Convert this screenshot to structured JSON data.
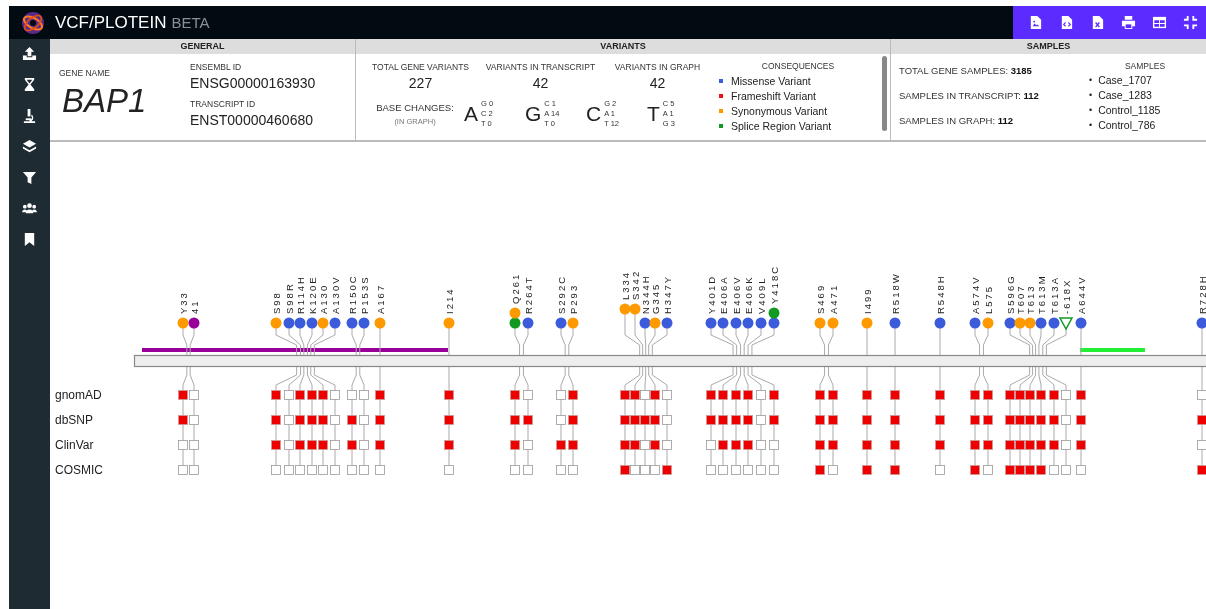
{
  "app": {
    "title": "VCF/PLOTEIN",
    "badge": "BETA"
  },
  "toolbar": [
    {
      "kind": "image-file"
    },
    {
      "kind": "code-file"
    },
    {
      "kind": "excel-file"
    },
    {
      "kind": "print"
    },
    {
      "kind": "table"
    },
    {
      "kind": "collapse"
    }
  ],
  "sidebar": [
    {
      "kind": "upload"
    },
    {
      "kind": "hourglass"
    },
    {
      "kind": "microscope"
    },
    {
      "kind": "layers"
    },
    {
      "kind": "filter"
    },
    {
      "kind": "users"
    },
    {
      "kind": "bookmark"
    }
  ],
  "general": {
    "heading": "GENERAL",
    "gene_name_label": "GENE NAME",
    "gene_name": "BAP1",
    "ensembl_label": "ENSEMBL ID",
    "ensembl_id": "ENSG00000163930",
    "transcript_label": "TRANSCRIPT ID",
    "transcript_id": "ENST00000460680"
  },
  "variants_panel": {
    "heading": "VARIANTS",
    "stats": [
      {
        "label": "TOTAL GENE VARIANTS",
        "value": "227"
      },
      {
        "label": "VARIANTS IN TRANSCRIPT",
        "value": "42"
      },
      {
        "label": "VARIANTS IN GRAPH",
        "value": "42"
      }
    ],
    "base_changes_label": "BASE CHANGES:",
    "base_changes_note": "(IN GRAPH)",
    "bases": [
      {
        "base": "A",
        "changes": [
          "G 0",
          "C 2",
          "T 0"
        ]
      },
      {
        "base": "G",
        "changes": [
          "C 1",
          "A 14",
          "T 0"
        ]
      },
      {
        "base": "C",
        "changes": [
          "G 2",
          "A 1",
          "T 12"
        ]
      },
      {
        "base": "T",
        "changes": [
          "C 5",
          "A 1",
          "G 3"
        ]
      }
    ],
    "consequences_heading": "CONSEQUENCES",
    "consequences": [
      {
        "label": "Missense Variant",
        "color": "#3b5bdb"
      },
      {
        "label": "Frameshift Variant",
        "color": "#ee1111"
      },
      {
        "label": "Synonymous Variant",
        "color": "#ff9900"
      },
      {
        "label": "Splice Region Variant",
        "color": "#119922"
      }
    ]
  },
  "samples_panel": {
    "heading": "SAMPLES",
    "stats": [
      {
        "label": "TOTAL GENE SAMPLES:",
        "value": "3185"
      },
      {
        "label": "SAMPLES IN TRANSCRIPT:",
        "value": "112"
      },
      {
        "label": "SAMPLES IN GRAPH:",
        "value": "112"
      }
    ],
    "list_heading": "SAMPLES",
    "bullet": "•",
    "samples": [
      "Case_1707",
      "Case_1283",
      "Control_1185",
      "Control_786"
    ]
  },
  "plot": {
    "databases": [
      "gnomAD",
      "dbSNP",
      "ClinVar",
      "COSMIC"
    ],
    "domains": [
      {
        "color": "#990099"
      },
      {
        "color": "#22ee33"
      }
    ],
    "variants": [
      {
        "label": "Y33",
        "kind": "circle",
        "dots": [
          {
            "color": "#ff9900"
          }
        ],
        "found": [
          true,
          true,
          false,
          false
        ]
      },
      {
        "label": "41",
        "kind": "circle",
        "dots": [
          {
            "color": "#990099"
          }
        ],
        "found": [
          false,
          false,
          false,
          false
        ]
      },
      {
        "label": "S98",
        "kind": "circle",
        "dots": [
          {
            "color": "#ff9900"
          }
        ],
        "found": [
          true,
          true,
          true,
          false
        ]
      },
      {
        "label": "S98R",
        "kind": "circle",
        "dots": [
          {
            "color": "#3b5bdb"
          }
        ],
        "found": [
          false,
          false,
          false,
          false
        ]
      },
      {
        "label": "R114H",
        "kind": "circle",
        "dots": [
          {
            "color": "#3b5bdb"
          }
        ],
        "found": [
          true,
          true,
          true,
          false
        ]
      },
      {
        "label": "K120E",
        "kind": "circle",
        "dots": [
          {
            "color": "#3b5bdb"
          }
        ],
        "found": [
          true,
          true,
          true,
          false
        ]
      },
      {
        "label": "A130",
        "kind": "circle",
        "dots": [
          {
            "color": "#ff9900"
          }
        ],
        "found": [
          true,
          true,
          true,
          false
        ]
      },
      {
        "label": "A130V",
        "kind": "circle",
        "dots": [
          {
            "color": "#3b5bdb"
          }
        ],
        "found": [
          false,
          false,
          false,
          false
        ]
      },
      {
        "label": "R150C",
        "kind": "circle",
        "dots": [
          {
            "color": "#3b5bdb"
          }
        ],
        "found": [
          false,
          true,
          true,
          false
        ]
      },
      {
        "label": "P153S",
        "kind": "circle",
        "dots": [
          {
            "color": "#3b5bdb"
          }
        ],
        "found": [
          false,
          false,
          false,
          false
        ]
      },
      {
        "label": "A167",
        "kind": "circle",
        "dots": [
          {
            "color": "#ff9900"
          }
        ],
        "found": [
          true,
          true,
          true,
          false
        ]
      },
      {
        "label": "I214",
        "kind": "circle",
        "dots": [
          {
            "color": "#ff9900"
          }
        ],
        "found": [
          true,
          true,
          true,
          false
        ]
      },
      {
        "label": "Q261",
        "kind": "circle",
        "dots": [
          {
            "color": "#ff9900"
          },
          {
            "color": "#119922"
          }
        ],
        "found": [
          true,
          true,
          true,
          false
        ]
      },
      {
        "label": "R264T",
        "kind": "circle",
        "dots": [
          {
            "color": "#3b5bdb"
          }
        ],
        "found": [
          false,
          true,
          false,
          false
        ]
      },
      {
        "label": "S292C",
        "kind": "circle",
        "dots": [
          {
            "color": "#3b5bdb"
          }
        ],
        "found": [
          false,
          false,
          true,
          false
        ]
      },
      {
        "label": "P293",
        "kind": "circle",
        "dots": [
          {
            "color": "#ff9900"
          }
        ],
        "found": [
          true,
          true,
          true,
          false
        ]
      },
      {
        "label": "L334",
        "kind": "raised",
        "dots": [
          {
            "color": "#ff9900"
          }
        ],
        "found": [
          true,
          true,
          true,
          true
        ]
      },
      {
        "label": "S342",
        "kind": "raised",
        "dots": [
          {
            "color": "#ff9900"
          }
        ],
        "found": [
          true,
          true,
          true,
          false
        ]
      },
      {
        "label": "N344H",
        "kind": "circle",
        "dots": [
          {
            "color": "#3b5bdb"
          }
        ],
        "found": [
          false,
          true,
          false,
          false
        ]
      },
      {
        "label": "G345",
        "kind": "circle",
        "dots": [
          {
            "color": "#ff9900"
          }
        ],
        "found": [
          true,
          true,
          true,
          false
        ]
      },
      {
        "label": "H347Y",
        "kind": "circle",
        "dots": [
          {
            "color": "#3b5bdb"
          }
        ],
        "found": [
          false,
          false,
          false,
          true
        ]
      },
      {
        "label": "Y401D",
        "kind": "circle",
        "dots": [
          {
            "color": "#3b5bdb"
          }
        ],
        "found": [
          true,
          true,
          false,
          false
        ]
      },
      {
        "label": "E406A",
        "kind": "circle",
        "dots": [
          {
            "color": "#3b5bdb"
          }
        ],
        "found": [
          true,
          true,
          true,
          false
        ]
      },
      {
        "label": "E406V",
        "kind": "circle",
        "dots": [
          {
            "color": "#3b5bdb"
          }
        ],
        "found": [
          true,
          true,
          true,
          false
        ]
      },
      {
        "label": "E406K",
        "kind": "circle",
        "dots": [
          {
            "color": "#3b5bdb"
          }
        ],
        "found": [
          true,
          true,
          true,
          false
        ]
      },
      {
        "label": "V409L",
        "kind": "circle",
        "dots": [
          {
            "color": "#3b5bdb"
          }
        ],
        "found": [
          false,
          false,
          false,
          false
        ]
      },
      {
        "label": "Y418C",
        "kind": "circle",
        "dots": [
          {
            "color": "#119922"
          },
          {
            "color": "#3b5bdb"
          }
        ],
        "found": [
          true,
          true,
          false,
          false
        ]
      },
      {
        "label": "S469",
        "kind": "circle",
        "dots": [
          {
            "color": "#ff9900"
          }
        ],
        "found": [
          true,
          true,
          true,
          true
        ]
      },
      {
        "label": "A471",
        "kind": "circle",
        "dots": [
          {
            "color": "#ff9900"
          }
        ],
        "found": [
          true,
          true,
          true,
          false
        ]
      },
      {
        "label": "I499",
        "kind": "circle",
        "dots": [
          {
            "color": "#ff9900"
          }
        ],
        "found": [
          true,
          true,
          true,
          true
        ]
      },
      {
        "label": "R518W",
        "kind": "circle",
        "dots": [
          {
            "color": "#3b5bdb"
          }
        ],
        "found": [
          true,
          true,
          true,
          true
        ]
      },
      {
        "label": "R548H",
        "kind": "circle",
        "dots": [
          {
            "color": "#3b5bdb"
          }
        ],
        "found": [
          true,
          true,
          true,
          false
        ]
      },
      {
        "label": "A574V",
        "kind": "circle",
        "dots": [
          {
            "color": "#3b5bdb"
          }
        ],
        "found": [
          true,
          true,
          true,
          true
        ]
      },
      {
        "label": "L575",
        "kind": "circle",
        "dots": [
          {
            "color": "#ff9900"
          }
        ],
        "found": [
          true,
          true,
          true,
          false
        ]
      },
      {
        "label": "S596G",
        "kind": "circle",
        "dots": [
          {
            "color": "#3b5bdb"
          }
        ],
        "found": [
          true,
          true,
          true,
          true
        ]
      },
      {
        "label": "T607",
        "kind": "circle",
        "dots": [
          {
            "color": "#ff9900"
          }
        ],
        "found": [
          true,
          true,
          true,
          true
        ]
      },
      {
        "label": "T613",
        "kind": "circle",
        "dots": [
          {
            "color": "#ff9900"
          }
        ],
        "found": [
          true,
          true,
          true,
          true
        ]
      },
      {
        "label": "T613M",
        "kind": "circle",
        "dots": [
          {
            "color": "#3b5bdb"
          }
        ],
        "found": [
          true,
          true,
          true,
          true
        ]
      },
      {
        "label": "T613A",
        "kind": "circle",
        "dots": [
          {
            "color": "#3b5bdb"
          }
        ],
        "found": [
          true,
          true,
          true,
          false
        ]
      },
      {
        "label": "-618X",
        "kind": "triangle",
        "dots": [
          {
            "color": "#119922"
          }
        ],
        "found": [
          false,
          false,
          false,
          false
        ]
      },
      {
        "label": "A644V",
        "kind": "circle",
        "dots": [
          {
            "color": "#3b5bdb"
          }
        ],
        "found": [
          true,
          true,
          true,
          false
        ]
      },
      {
        "label": "R728H",
        "kind": "circle",
        "dots": [
          {
            "color": "#3b5bdb"
          }
        ],
        "found": [
          false,
          true,
          false,
          true
        ]
      }
    ]
  }
}
